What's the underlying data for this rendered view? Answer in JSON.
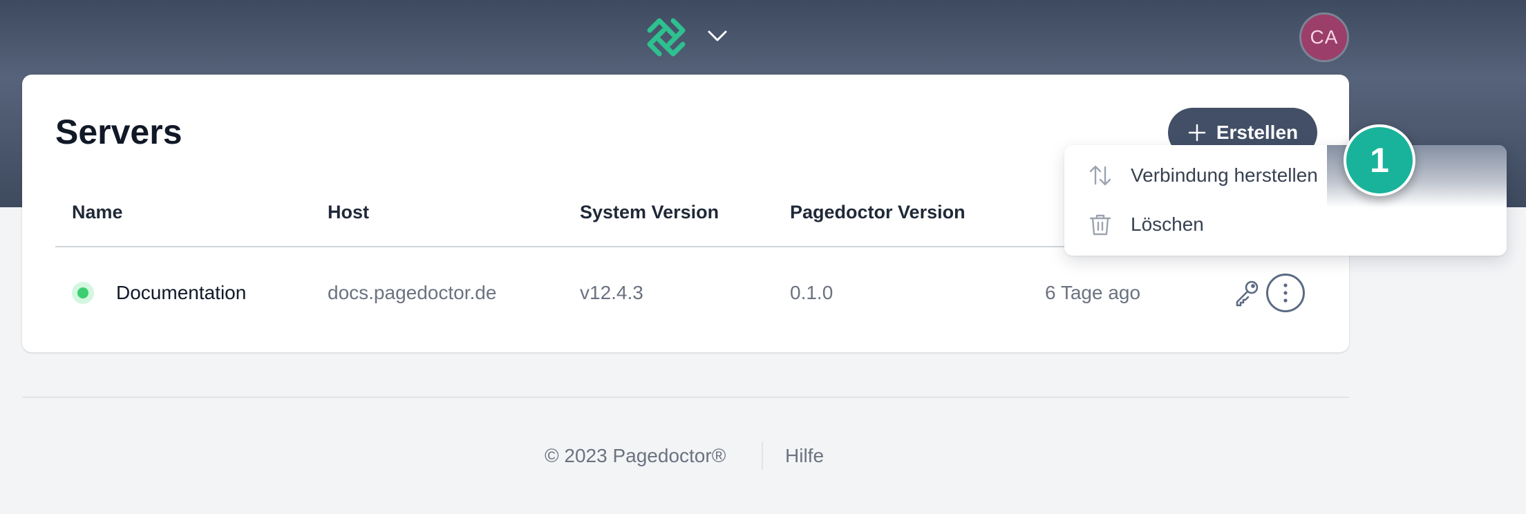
{
  "header": {
    "logo_icon": "pagedoctor-logo-icon",
    "logo_color": "#2fc08f",
    "avatar_initials": "CA",
    "avatar_color": "#9b3e6a"
  },
  "main": {
    "title": "Servers",
    "create_label": "Erstellen",
    "table": {
      "columns": [
        "Name",
        "Host",
        "System Version",
        "Pagedoctor Version"
      ],
      "rows": [
        {
          "status": "online",
          "name": "Documentation",
          "host": "docs.pagedoctor.de",
          "system_version": "v12.4.3",
          "pagedoctor_version": "0.1.0",
          "updated": "6 Tage ago"
        }
      ]
    }
  },
  "dropdown": {
    "items": [
      {
        "label": "Verbindung herstellen",
        "icon": "arrows-up-down-icon"
      },
      {
        "label": "Löschen",
        "icon": "trash-icon"
      }
    ]
  },
  "step_badge": "1",
  "footer": {
    "copyright": "© 2023 Pagedoctor®",
    "help": "Hilfe"
  }
}
